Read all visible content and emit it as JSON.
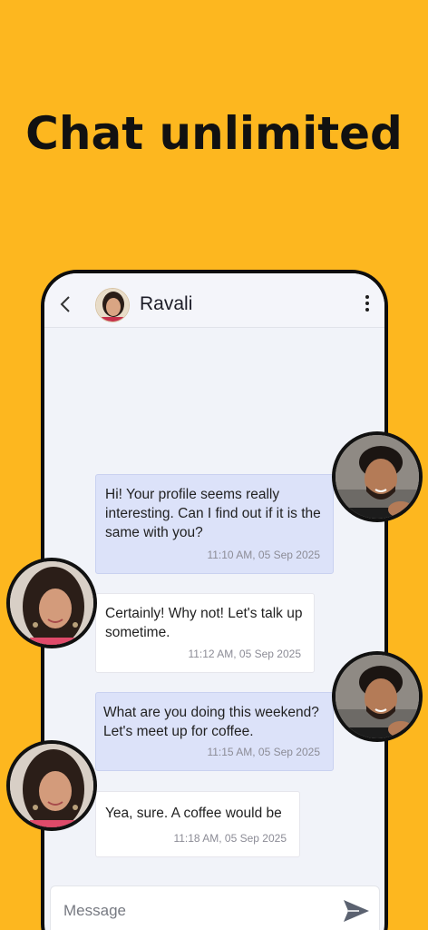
{
  "headline": "Chat unlimited",
  "chat": {
    "contact_name": "Ravali",
    "back_icon": "chevron-left-icon",
    "menu_icon": "more-vertical-icon"
  },
  "messages": [
    {
      "direction": "sent",
      "text": "Hi! Your profile seems really interesting. Can I find out if it is the same with you?",
      "time": "11:10 AM, 05 Sep 2025"
    },
    {
      "direction": "received",
      "text": "Certainly! Why not! Let's talk up sometime.",
      "time": "11:12 AM, 05 Sep 2025"
    },
    {
      "direction": "sent",
      "text": "What are you doing this weekend? Let's meet up for coffee.",
      "time": "11:15 AM, 05 Sep 2025"
    },
    {
      "direction": "received",
      "text": "Yea, sure. A coffee would be",
      "time": "11:18 AM, 05 Sep 2025"
    }
  ],
  "composer": {
    "placeholder": "Message",
    "send_icon": "send-icon"
  },
  "colors": {
    "background": "#FDB71F",
    "sent_bubble": "#DCE2F9",
    "received_bubble": "#FFFFFF",
    "chat_background": "#F1F3F9"
  }
}
